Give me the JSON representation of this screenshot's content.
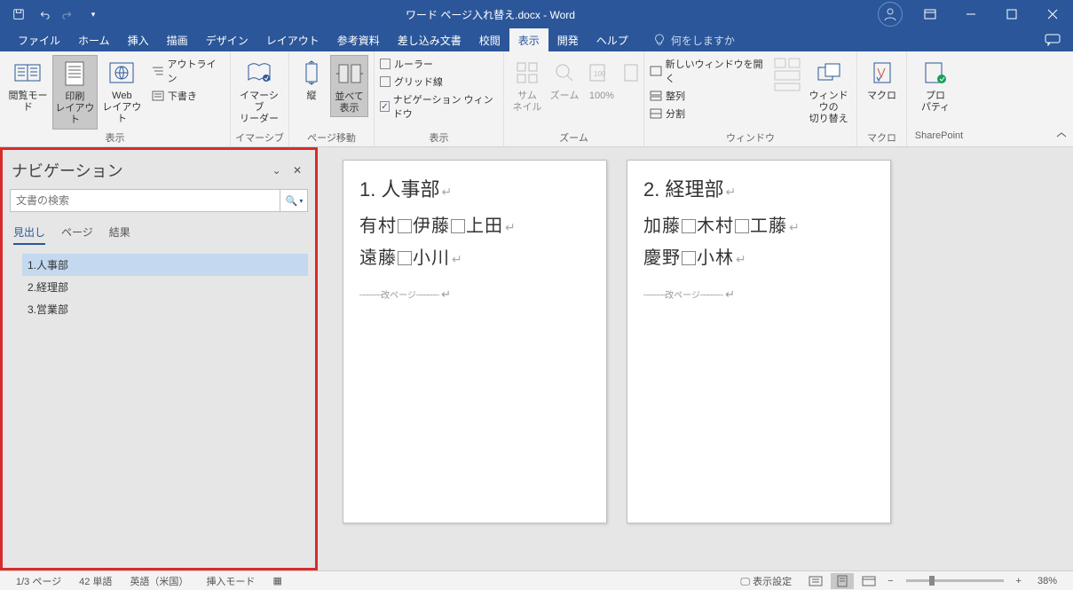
{
  "title": "ワード ページ入れ替え.docx - Word",
  "tabs": {
    "file": "ファイル",
    "home": "ホーム",
    "insert": "挿入",
    "draw": "描画",
    "design": "デザイン",
    "layout": "レイアウト",
    "references": "参考資料",
    "mailings": "差し込み文書",
    "review": "校閲",
    "view": "表示",
    "developer": "開発",
    "help": "ヘルプ"
  },
  "tellme_placeholder": "何をしますか",
  "ribbon": {
    "views": {
      "read": "閲覧モード",
      "print": "印刷\nレイアウト",
      "web": "Web\nレイアウト",
      "outline": "アウトライン",
      "draft": "下書き",
      "group": "表示"
    },
    "immersive": {
      "reader": "イマーシブ\nリーダー",
      "group": "イマーシブ"
    },
    "pagemove": {
      "vertical": "縦",
      "side": "並べて\n表示",
      "group": "ページ移動"
    },
    "show": {
      "ruler": "ルーラー",
      "grid": "グリッド線",
      "nav": "ナビゲーション ウィンドウ",
      "group": "表示"
    },
    "zoom": {
      "thumb": "サム\nネイル",
      "zoom": "ズーム",
      "hundred": "100%",
      "group": "ズーム"
    },
    "window": {
      "newwin": "新しいウィンドウを開く",
      "arrange": "整列",
      "split": "分割",
      "switch": "ウィンドウの\n切り替え",
      "group": "ウィンドウ"
    },
    "macro": {
      "macro": "マクロ",
      "group": "マクロ"
    },
    "sharepoint": {
      "prop": "プロ\nパティ",
      "group": "SharePoint"
    }
  },
  "nav": {
    "title": "ナビゲーション",
    "search_placeholder": "文書の検索",
    "tabs": {
      "headings": "見出し",
      "pages": "ページ",
      "results": "結果"
    },
    "items": [
      "1.人事部",
      "2.経理部",
      "3.営業部"
    ]
  },
  "doc": {
    "page1": {
      "h": "1. 人事部",
      "l1a": "有村",
      "l1b": "伊藤",
      "l1c": "上田",
      "l2a": "遠藤",
      "l2b": "小川",
      "break": "改ページ"
    },
    "page2": {
      "h": "2. 経理部",
      "l1a": "加藤",
      "l1b": "木村",
      "l1c": "工藤",
      "l2a": "慶野",
      "l2b": "小林",
      "break": "改ページ"
    }
  },
  "status": {
    "page": "1/3 ページ",
    "words": "42 単語",
    "lang": "英語（米国）",
    "mode": "挿入モード",
    "display": "表示設定",
    "zoom": "38%"
  }
}
